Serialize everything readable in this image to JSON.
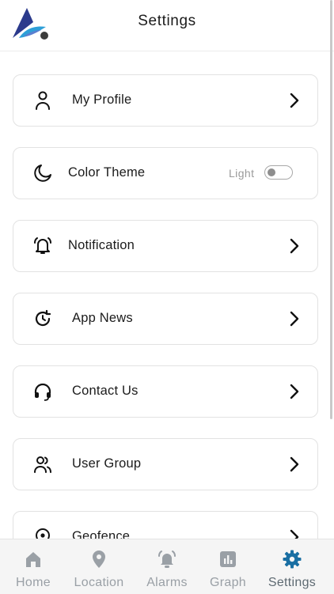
{
  "header": {
    "title": "Settings"
  },
  "settings": {
    "items": [
      {
        "label": "My Profile",
        "icon": "user-icon"
      },
      {
        "label": "Color Theme",
        "icon": "moon-icon",
        "toggle_label": "Light",
        "toggle_on": false
      },
      {
        "label": "Notification",
        "icon": "bell-ringing-icon"
      },
      {
        "label": "App News",
        "icon": "refresh-clock-icon"
      },
      {
        "label": "Contact Us",
        "icon": "headset-icon"
      },
      {
        "label": "User Group",
        "icon": "users-icon"
      },
      {
        "label": "Geofence",
        "icon": "location-target-icon"
      }
    ]
  },
  "tabs": [
    {
      "label": "Home",
      "icon": "home-icon",
      "active": false
    },
    {
      "label": "Location",
      "icon": "location-pin-icon",
      "active": false
    },
    {
      "label": "Alarms",
      "icon": "alarm-bell-icon",
      "active": false
    },
    {
      "label": "Graph",
      "icon": "bar-chart-icon",
      "active": false
    },
    {
      "label": "Settings",
      "icon": "gear-icon",
      "active": true
    }
  ],
  "colors": {
    "accent": "#1a6fa3",
    "tab_inactive": "#9aa0a6",
    "logo_dark": "#2b3a8c",
    "logo_light": "#2e9fd8"
  }
}
